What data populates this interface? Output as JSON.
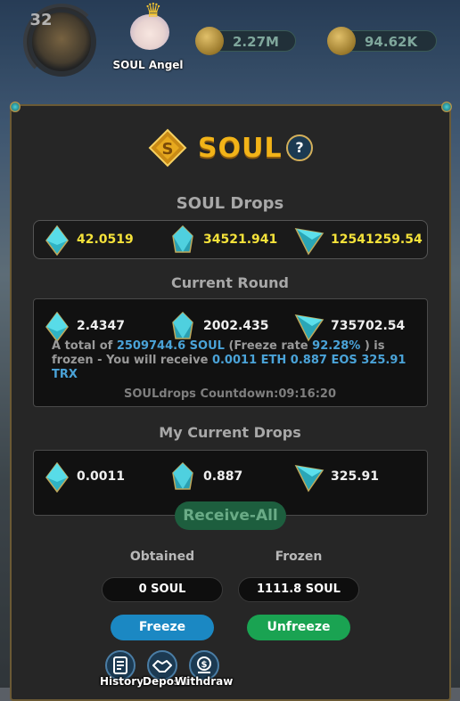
{
  "header": {
    "level": "32",
    "player_name": "SOUL Angel",
    "gold": "2.27M",
    "resource2": "94.62K"
  },
  "panel": {
    "title": "SOUL",
    "help_label": "?",
    "soul_drops": {
      "title": "SOUL Drops",
      "values": [
        "42.0519",
        "34521.941",
        "12541259.54"
      ]
    },
    "current_round": {
      "title": "Current Round",
      "values": [
        "2.4347",
        "2002.435",
        "735702.54"
      ],
      "info": {
        "prefix": "A total of",
        "amount": "2509744.6 SOUL",
        "freeze_label": "(Freeze rate",
        "freeze_rate": "92.28%",
        "suffix": ") is frozen - You will receive",
        "receive": "0.0011 ETH 0.887 EOS 325.91 TRX"
      },
      "countdown": "SOULdrops Countdown:09:16:20"
    },
    "my_drops": {
      "title": "My Current Drops",
      "values": [
        "0.0011",
        "0.887",
        "325.91"
      ]
    },
    "receive_all": "Receive-All",
    "obtained": {
      "label": "Obtained",
      "value": "0 SOUL"
    },
    "frozen": {
      "label": "Frozen",
      "value": "1111.8 SOUL"
    },
    "freeze_btn": "Freeze",
    "unfreeze_btn": "Unfreeze",
    "bottom": {
      "history": "History",
      "deposit": "Deposit",
      "withdraw": "Withdraw"
    }
  },
  "colors": {
    "accent_gold": "#f2b318",
    "freeze": "#1b88c3",
    "unfreeze": "#1aa352",
    "highlight_blue": "#4aa3d8",
    "value_yellow": "#f5e23a"
  }
}
